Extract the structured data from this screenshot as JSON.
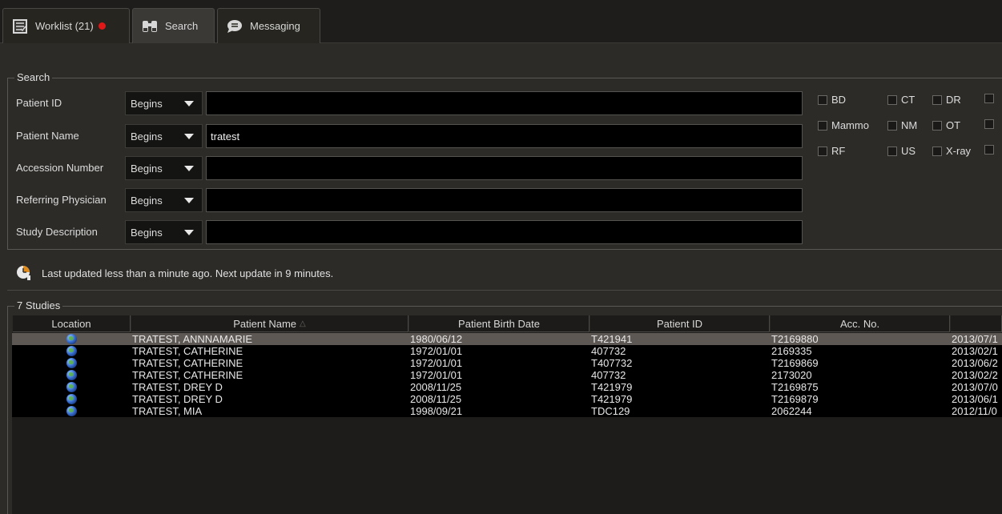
{
  "tabs": [
    {
      "label": "Worklist (21)",
      "icon": "worklist-icon",
      "alert": true
    },
    {
      "label": "Search",
      "icon": "binoculars-icon",
      "active": true
    },
    {
      "label": "Messaging",
      "icon": "speech-bubble-icon"
    }
  ],
  "search": {
    "title": "Search",
    "rows": [
      {
        "label": "Patient ID",
        "mode": "Begins",
        "value": ""
      },
      {
        "label": "Patient Name",
        "mode": "Begins",
        "value": "tratest"
      },
      {
        "label": "Accession Number",
        "mode": "Begins",
        "value": ""
      },
      {
        "label": "Referring Physician",
        "mode": "Begins",
        "value": ""
      },
      {
        "label": "Study Description",
        "mode": "Begins",
        "value": ""
      }
    ],
    "modalities": [
      [
        "BD",
        "CT",
        "DR"
      ],
      [
        "Mammo",
        "NM",
        "OT"
      ],
      [
        "RF",
        "US",
        "X-ray"
      ]
    ]
  },
  "status": {
    "text": "Last updated less than a minute ago. Next update in 9 minutes."
  },
  "results": {
    "title": "7 Studies",
    "columns": [
      "Location",
      "Patient Name",
      "Patient Birth Date",
      "Patient ID",
      "Acc. No.",
      ""
    ],
    "sort_column": "Patient Name",
    "rows": [
      {
        "name": "TRATEST, ANNNAMARIE",
        "dob": "1980/06/12",
        "pid": "T421941",
        "acc": "T2169880",
        "date": "2013/07/1",
        "selected": true
      },
      {
        "name": "TRATEST, CATHERINE",
        "dob": "1972/01/01",
        "pid": "407732",
        "acc": "2169335",
        "date": "2013/02/1"
      },
      {
        "name": "TRATEST, CATHERINE",
        "dob": "1972/01/01",
        "pid": "T407732",
        "acc": "T2169869",
        "date": "2013/06/2"
      },
      {
        "name": "TRATEST, CATHERINE",
        "dob": "1972/01/01",
        "pid": "407732",
        "acc": "2173020",
        "date": "2013/02/2"
      },
      {
        "name": "TRATEST, DREY D",
        "dob": "2008/11/25",
        "pid": "T421979",
        "acc": "T2169875",
        "date": "2013/07/0"
      },
      {
        "name": "TRATEST, DREY D",
        "dob": "2008/11/25",
        "pid": "T421979",
        "acc": "T2169879",
        "date": "2013/06/1"
      },
      {
        "name": "TRATEST, MIA",
        "dob": "1998/09/21",
        "pid": "TDC129",
        "acc": "2062244",
        "date": "2012/11/0"
      }
    ]
  }
}
